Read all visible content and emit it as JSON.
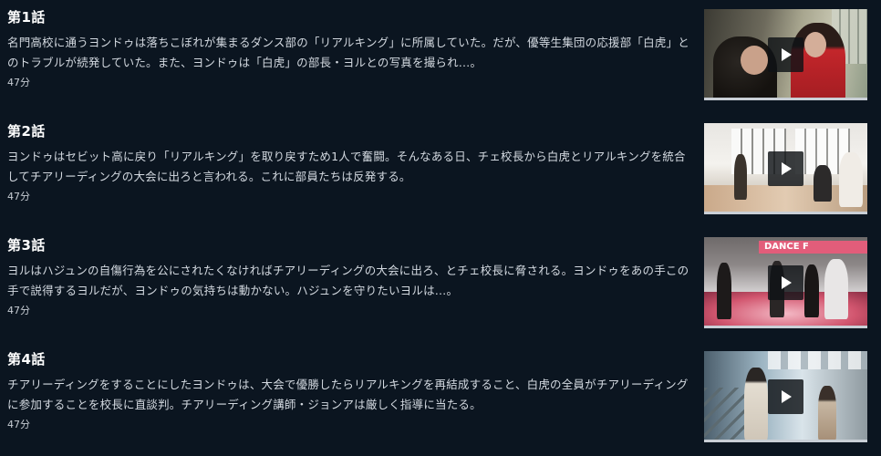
{
  "episodes": [
    {
      "title": "第1話",
      "description": "名門高校に通うヨンドゥは落ちこぼれが集まるダンス部の「リアルキング」に所属していた。だが、優等生集団の応援部「白虎」とのトラブルが続発していた。また、ヨンドゥは「白虎」の部長・ヨルとの写真を撮られ…。",
      "duration": "47分"
    },
    {
      "title": "第2話",
      "description": "ヨンドゥはセビット高に戻り「リアルキング」を取り戻すため1人で奮闘。そんなある日、チェ校長から白虎とリアルキングを統合してチアリーディングの大会に出ろと言われる。これに部員たちは反発する。",
      "duration": "47分"
    },
    {
      "title": "第3話",
      "description": "ヨルはハジュンの自傷行為を公にされたくなければチアリーディングの大会に出ろ、とチェ校長に脅される。ヨンドゥをあの手この手で説得するヨルだが、ヨンドゥの気持ちは動かない。ハジュンを守りたいヨルは…。",
      "duration": "47分"
    },
    {
      "title": "第4話",
      "description": "チアリーディングをすることにしたヨンドゥは、大会で優勝したらリアルキングを再結成すること、白虎の全員がチアリーディングに参加することを校長に直談判。チアリーディング講師・ジョンアは厳しく指導に当たる。",
      "duration": "47分"
    }
  ],
  "thumbnail_banner_text": "DANCE F",
  "play_icon": "play-icon",
  "colors": {
    "background": "#0b1520",
    "title": "#ffffff",
    "text": "#d3d9e0",
    "progress": "#c9cfd6"
  }
}
